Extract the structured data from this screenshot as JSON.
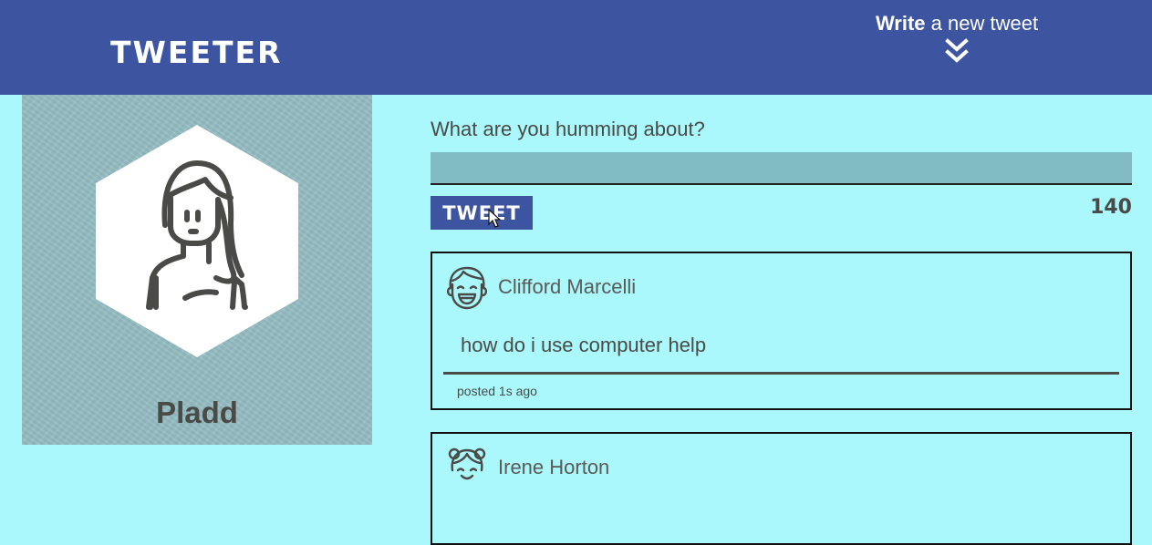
{
  "nav": {
    "brand": "Tweeter",
    "compose_bold": "Write",
    "compose_rest": " a new tweet"
  },
  "profile": {
    "name": "Pladd"
  },
  "composer": {
    "prompt": "What are you humming about?",
    "input_value": "",
    "button_label": "Tweet",
    "char_count": "140"
  },
  "tweets": [
    {
      "author": "Clifford Marcelli",
      "content": "how do i use computer help",
      "posted": "posted 1s ago"
    },
    {
      "author": "Irene Horton",
      "content": "",
      "posted": ""
    }
  ],
  "colors": {
    "nav_bg": "#3d55a0",
    "page_bg": "#aaf8fb",
    "input_bg": "#80bcc1",
    "text": "#4a4a46"
  }
}
